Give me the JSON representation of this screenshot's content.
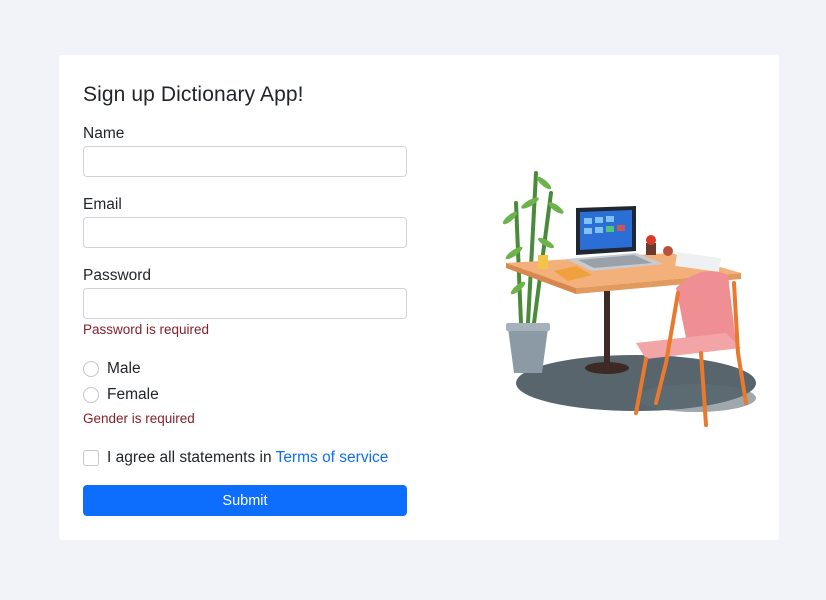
{
  "form": {
    "title": "Sign up Dictionary App!",
    "name_label": "Name",
    "name_value": "",
    "email_label": "Email",
    "email_value": "",
    "password_label": "Password",
    "password_value": "",
    "password_error": "Password is required",
    "gender_options": [
      "Male",
      "Female"
    ],
    "gender_error": "Gender is required",
    "terms_prefix": "I agree all statements in",
    "terms_link": "Terms of service",
    "submit_label": "Submit"
  },
  "colors": {
    "page_bg": "#f2f3f8",
    "primary": "#0d6efd",
    "error": "#842029"
  },
  "illustration": {
    "icon": "desk-workspace-illustration"
  }
}
